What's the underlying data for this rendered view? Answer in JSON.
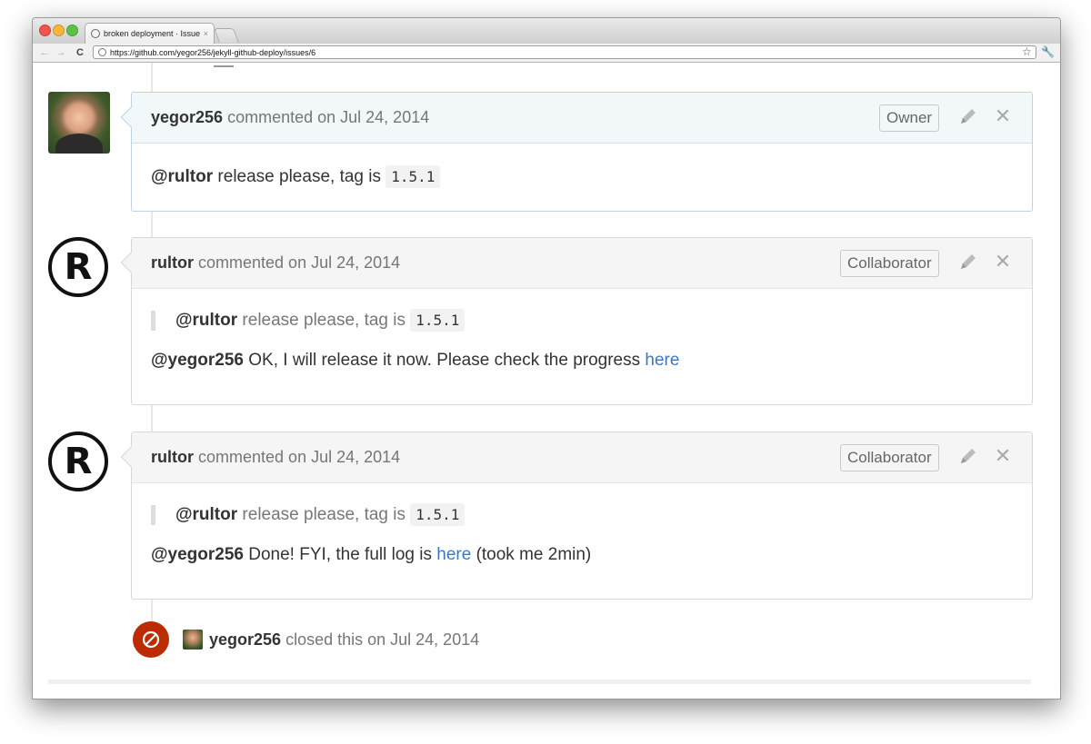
{
  "browser": {
    "tab_title": "broken deployment · Issue #",
    "tab_close": "×",
    "url": "https://github.com/yegor256/jekyll-github-deploy/issues/6",
    "nav": {
      "back": "←",
      "forward": "→",
      "reload": "C"
    }
  },
  "comments": [
    {
      "author": "yegor256",
      "action": "commented on Jul 24, 2014",
      "role": "Owner",
      "mention": "@rultor",
      "text": "release please, tag is",
      "code": "1.5.1"
    },
    {
      "author": "rultor",
      "action": "commented on Jul 24, 2014",
      "role": "Collaborator",
      "quote_mention": "@rultor",
      "quote_text": "release please, tag is",
      "quote_code": "1.5.1",
      "reply_mention": "@yegor256",
      "reply_text": "OK, I will release it now. Please check the progress",
      "reply_link": "here"
    },
    {
      "author": "rultor",
      "action": "commented on Jul 24, 2014",
      "role": "Collaborator",
      "quote_mention": "@rultor",
      "quote_text": "release please, tag is",
      "quote_code": "1.5.1",
      "reply_mention": "@yegor256",
      "reply_text": "Done! FYI, the full log is",
      "reply_link": "here",
      "reply_suffix": "(took me 2min)"
    }
  ],
  "rultor_avatar_letter": "R",
  "close_icon_glyph": "✕",
  "event": {
    "author": "yegor256",
    "text": "closed this on Jul 24, 2014"
  },
  "colors": {
    "link": "#4078c0",
    "closed_badge": "#bd2c00",
    "owner_header": "#f2f8fa"
  }
}
